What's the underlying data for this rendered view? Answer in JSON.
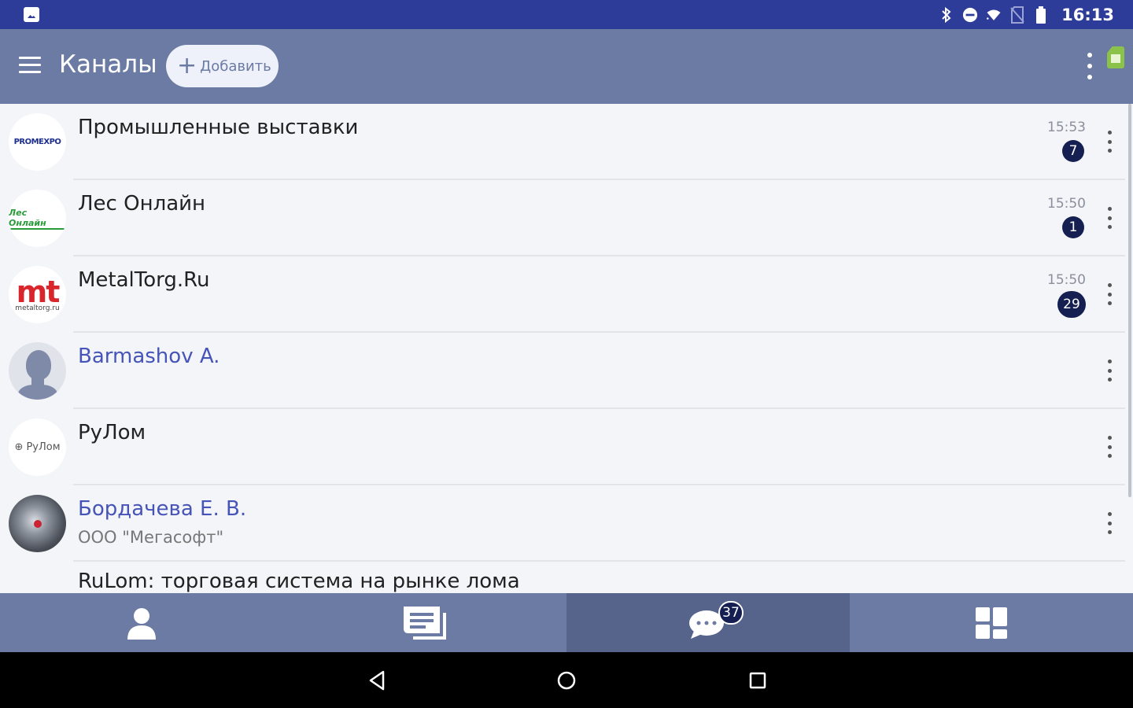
{
  "status_bar": {
    "time": "16:13",
    "icons": [
      "bluetooth-icon",
      "do-not-disturb-icon",
      "wifi-icon",
      "no-sim-icon",
      "battery-icon"
    ]
  },
  "app_bar": {
    "title": "Каналы",
    "add_button_label": "Добавить",
    "icons": [
      "menu-icon",
      "plus-icon",
      "more-vert-icon",
      "sim-card-icon"
    ]
  },
  "channels": [
    {
      "name": "Промышленные выставки",
      "time": "15:53",
      "unread": "7",
      "avatar": "promexpo-logo",
      "avatar_text": "PROMEXPO"
    },
    {
      "name": "Лес Онлайн",
      "time": "15:50",
      "unread": "1",
      "avatar": "les-online-logo",
      "avatar_text": "Лес Онлайн"
    },
    {
      "name": "MetalTorg.Ru",
      "time": "15:50",
      "unread": "29",
      "avatar": "metaltorg-logo",
      "avatar_text": "mt",
      "avatar_subtext": "metaltorg.ru"
    },
    {
      "name": "Barmashov A.",
      "avatar": "person-placeholder-icon"
    },
    {
      "name": "РуЛом",
      "avatar": "rulom-logo",
      "avatar_text": "РуЛом"
    },
    {
      "name": "Бордачева Е. В.",
      "subtitle": "ООО \"Мегасофт\"",
      "avatar": "user-photo"
    },
    {
      "name": "RuLom: торговая система на рынке лома",
      "avatar": "group-icon"
    }
  ],
  "bottom_nav": {
    "items": [
      {
        "icon": "person-icon"
      },
      {
        "icon": "news-icon"
      },
      {
        "icon": "chat-bubble-icon",
        "badge": "37",
        "active": true
      },
      {
        "icon": "grid-icon"
      }
    ]
  },
  "system_nav": {
    "icons": [
      "back-icon",
      "home-icon",
      "recents-icon"
    ]
  },
  "colors": {
    "status_bar": "#2e3c99",
    "app_bar": "#6b7ba3",
    "badge": "#151f52",
    "link_name": "#4654b8",
    "list_bg": "#f4f5f9"
  }
}
